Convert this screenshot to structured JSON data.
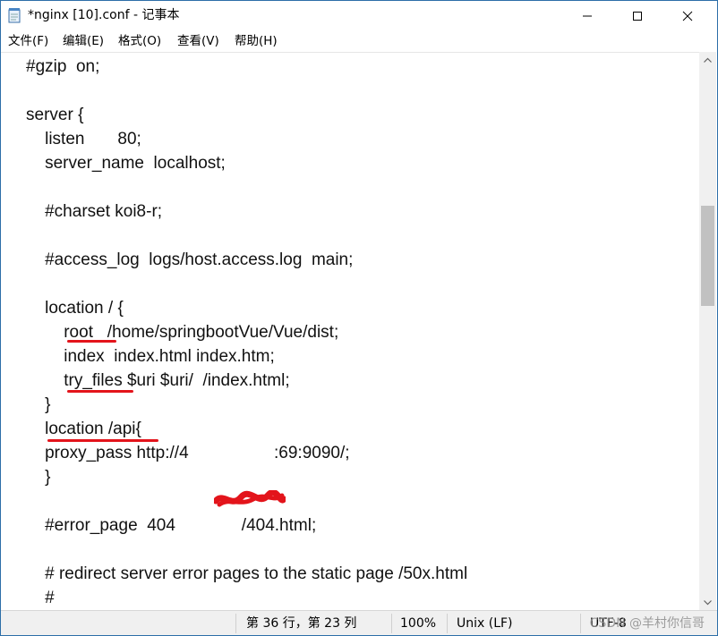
{
  "window": {
    "title": "*nginx [10].conf - 记事本"
  },
  "menu": [
    "文件(F)",
    "编辑(E)",
    "格式(O)",
    "查看(V)",
    "帮助(H)"
  ],
  "lines": [
    "#gzip  on;",
    "",
    "server {",
    "    listen       80;",
    "    server_name  localhost;",
    "",
    "    #charset koi8-r;",
    "",
    "    #access_log  logs/host.access.log  main;",
    "",
    "    location / {",
    "        root   /home/springbootVue/Vue/dist;",
    "        index  index.html index.htm;",
    "        try_files $uri $uri/  /index.html;",
    "    }",
    "    location /api{",
    "    proxy_pass http://4",
    "    }",
    "",
    "    #error_page  404              /404.html;",
    "",
    "    # redirect server error pages to the static page /50x.html",
    "    #"
  ],
  "proxy_port_fragment": ":69:9090/;",
  "status": {
    "position": "第 36 行，第 23 列",
    "zoom": "100%",
    "line_ending": "Unix (LF)",
    "encoding": "UTF-8"
  },
  "watermark": "CSDN @羊村你信哥",
  "colors": {
    "annotation": "#e3141b",
    "window_border": "#2d6ea8"
  },
  "icons": [
    "notepad-icon",
    "minimize-icon",
    "maximize-icon",
    "close-icon",
    "scroll-up-arrow-icon",
    "scroll-down-arrow-icon"
  ]
}
